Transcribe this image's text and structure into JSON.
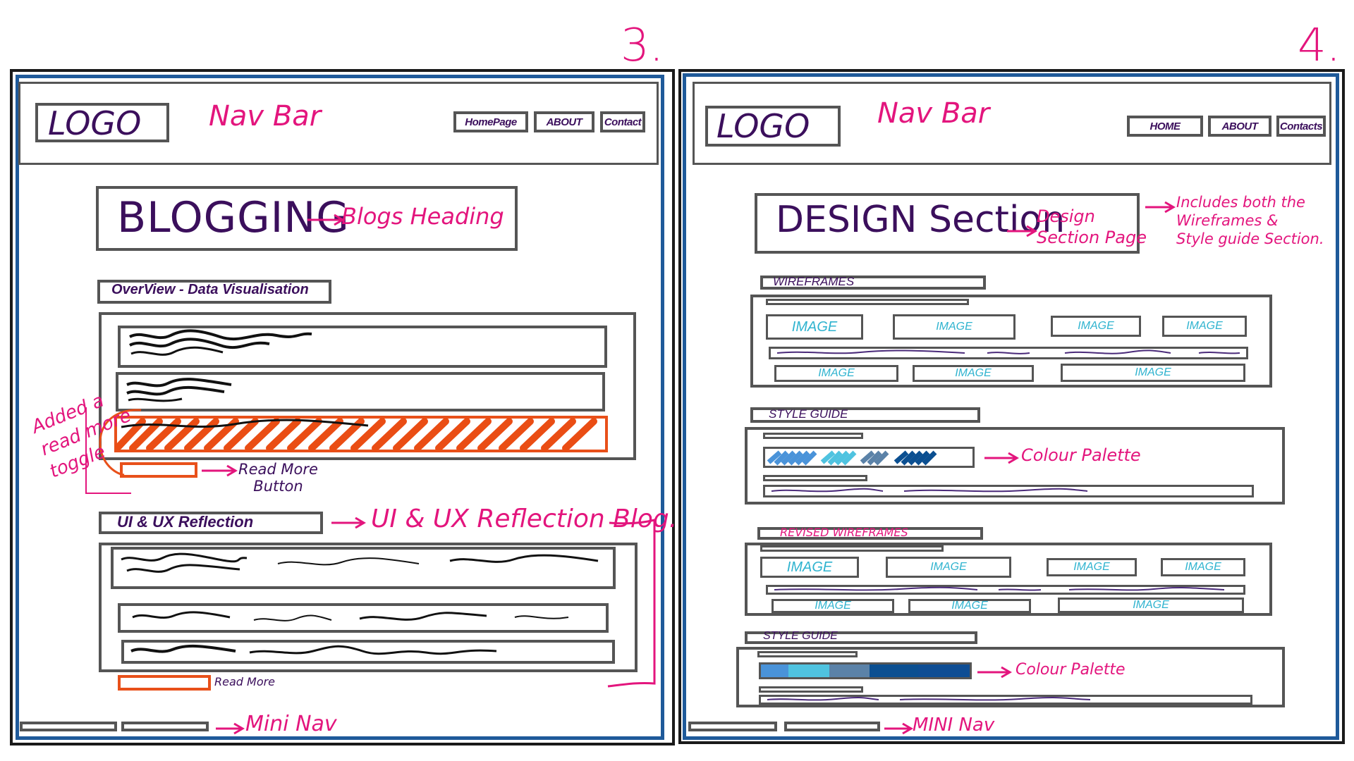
{
  "panel_numbers": {
    "left": "3.",
    "right": "4."
  },
  "left": {
    "logo": "LOGO",
    "nav_bar": "Nav Bar",
    "nav_items": [
      "HomePage",
      "ABOUT",
      "Contact"
    ],
    "heading": "BLOGGING",
    "heading_note": "Blogs Heading",
    "overview_label": "OverView - Data Visualisation",
    "toggle_note": [
      "Added a",
      "read more",
      "toggle"
    ],
    "read_more_note": [
      "Read More",
      "Button"
    ],
    "ux_label": "UI & UX Reflection",
    "ux_note": "UI & UX Reflection Blog.",
    "read_more_small": "Read More",
    "mini_nav": "Mini Nav"
  },
  "right": {
    "logo": "LOGO",
    "nav_bar": "Nav Bar",
    "nav_items": [
      "HOME",
      "ABOUT",
      "Contacts"
    ],
    "heading": "DESIGN Section",
    "heading_note": [
      "Design",
      "Section Page"
    ],
    "side_note": [
      "Includes both the",
      "Wireframes &",
      "Style guide Section."
    ],
    "wireframes_label": "WIREFRAMES",
    "image_label": "IMAGE",
    "style_guide_label": "STYLE GUIDE",
    "colour_palette": "Colour Palette",
    "revised_label": "REVISED WIREFRAMES",
    "mini_nav": "MINI Nav"
  },
  "colors": {
    "palette_swatches": [
      "#4a93d9",
      "#4fc3e0",
      "#5b82a8",
      "#0b4f91",
      "#0e4d94"
    ]
  }
}
